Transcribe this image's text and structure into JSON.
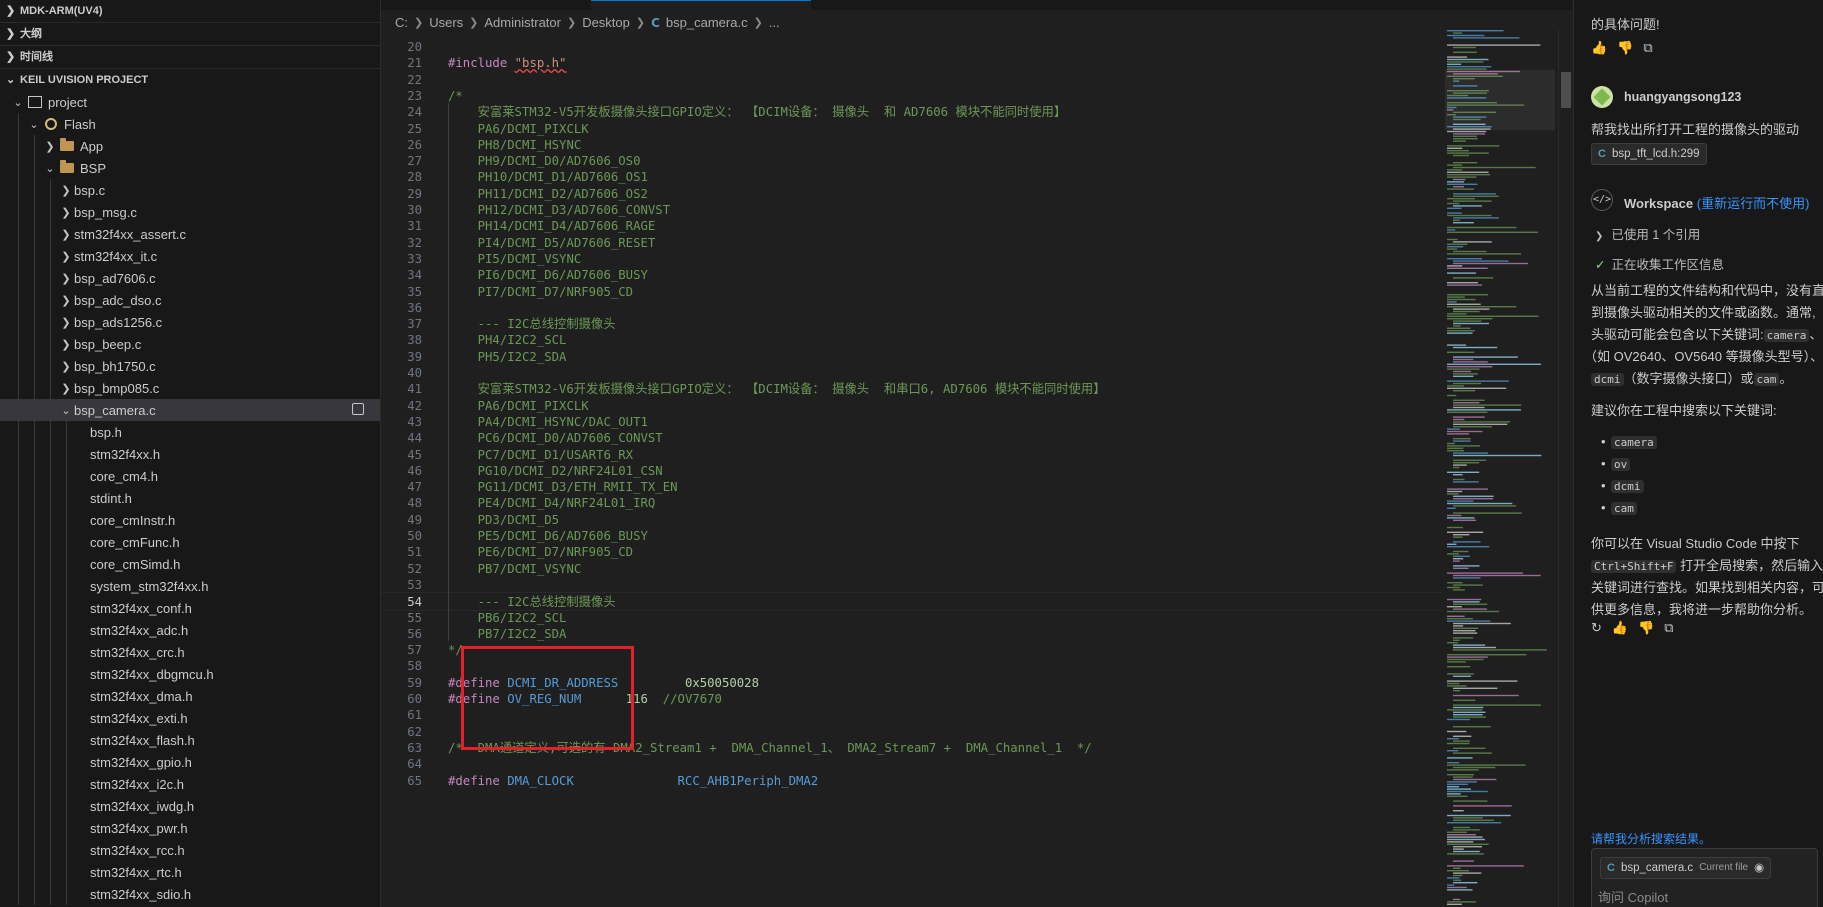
{
  "explorer": {
    "sections": [
      {
        "label": "MDK-ARM(UV4)",
        "expanded": false
      },
      {
        "label": "大纲",
        "expanded": false
      },
      {
        "label": "时间线",
        "expanded": false
      },
      {
        "label": "KEIL UVISION PROJECT",
        "expanded": true
      }
    ],
    "tree": [
      {
        "label": "project",
        "depth": 1,
        "chevron": "down",
        "icon": "project-icon"
      },
      {
        "label": "Flash",
        "depth": 2,
        "chevron": "down",
        "icon": "flash-target-icon"
      },
      {
        "label": "App",
        "depth": 3,
        "chevron": "right",
        "icon": "folder-icon"
      },
      {
        "label": "BSP",
        "depth": 3,
        "chevron": "down",
        "icon": "folder-icon"
      },
      {
        "label": "bsp.c",
        "depth": 4,
        "chevron": "right"
      },
      {
        "label": "bsp_msg.c",
        "depth": 4,
        "chevron": "right"
      },
      {
        "label": "stm32f4xx_assert.c",
        "depth": 4,
        "chevron": "right"
      },
      {
        "label": "stm32f4xx_it.c",
        "depth": 4,
        "chevron": "right"
      },
      {
        "label": "bsp_ad7606.c",
        "depth": 4,
        "chevron": "right"
      },
      {
        "label": "bsp_adc_dso.c",
        "depth": 4,
        "chevron": "right"
      },
      {
        "label": "bsp_ads1256.c",
        "depth": 4,
        "chevron": "right"
      },
      {
        "label": "bsp_beep.c",
        "depth": 4,
        "chevron": "right"
      },
      {
        "label": "bsp_bh1750.c",
        "depth": 4,
        "chevron": "right"
      },
      {
        "label": "bsp_bmp085.c",
        "depth": 4,
        "chevron": "right"
      },
      {
        "label": "bsp_camera.c",
        "depth": 4,
        "chevron": "down",
        "selected": true
      },
      {
        "label": "bsp.h",
        "depth": 5
      },
      {
        "label": "stm32f4xx.h",
        "depth": 5
      },
      {
        "label": "core_cm4.h",
        "depth": 5
      },
      {
        "label": "stdint.h",
        "depth": 5
      },
      {
        "label": "core_cmInstr.h",
        "depth": 5
      },
      {
        "label": "core_cmFunc.h",
        "depth": 5
      },
      {
        "label": "core_cmSimd.h",
        "depth": 5
      },
      {
        "label": "system_stm32f4xx.h",
        "depth": 5
      },
      {
        "label": "stm32f4xx_conf.h",
        "depth": 5
      },
      {
        "label": "stm32f4xx_adc.h",
        "depth": 5
      },
      {
        "label": "stm32f4xx_crc.h",
        "depth": 5
      },
      {
        "label": "stm32f4xx_dbgmcu.h",
        "depth": 5
      },
      {
        "label": "stm32f4xx_dma.h",
        "depth": 5
      },
      {
        "label": "stm32f4xx_exti.h",
        "depth": 5
      },
      {
        "label": "stm32f4xx_flash.h",
        "depth": 5
      },
      {
        "label": "stm32f4xx_gpio.h",
        "depth": 5
      },
      {
        "label": "stm32f4xx_i2c.h",
        "depth": 5
      },
      {
        "label": "stm32f4xx_iwdg.h",
        "depth": 5
      },
      {
        "label": "stm32f4xx_pwr.h",
        "depth": 5
      },
      {
        "label": "stm32f4xx_rcc.h",
        "depth": 5
      },
      {
        "label": "stm32f4xx_rtc.h",
        "depth": 5
      },
      {
        "label": "stm32f4xx_sdio.h",
        "depth": 5
      }
    ]
  },
  "breadcrumb": [
    "C:",
    "Users",
    "Administrator",
    "Desktop",
    "bsp_camera.c",
    "..."
  ],
  "editor": {
    "current_line": 54,
    "lines": [
      {
        "n": 20,
        "segs": []
      },
      {
        "n": 21,
        "segs": [
          {
            "c": "kw",
            "t": "#include"
          },
          {
            "c": "plain",
            "t": " "
          },
          {
            "c": "str squig",
            "t": "\"bsp.h\""
          }
        ]
      },
      {
        "n": 22,
        "segs": []
      },
      {
        "n": 23,
        "segs": [
          {
            "c": "cm",
            "t": "/*"
          }
        ]
      },
      {
        "n": 24,
        "segs": [
          {
            "c": "cm",
            "t": "    安富莱STM32-V5开发板摄像头接口GPIO定义： 【DCIM设备： 摄像头  和 AD7606 模块不能同时使用】"
          }
        ]
      },
      {
        "n": 25,
        "segs": [
          {
            "c": "cm",
            "t": "    PA6/DCMI_PIXCLK"
          }
        ]
      },
      {
        "n": 26,
        "segs": [
          {
            "c": "cm",
            "t": "    PH8/DCMI_HSYNC"
          }
        ]
      },
      {
        "n": 27,
        "segs": [
          {
            "c": "cm",
            "t": "    PH9/DCMI_D0/AD7606_OS0"
          }
        ]
      },
      {
        "n": 28,
        "segs": [
          {
            "c": "cm",
            "t": "    PH10/DCMI_D1/AD7606_OS1"
          }
        ]
      },
      {
        "n": 29,
        "segs": [
          {
            "c": "cm",
            "t": "    PH11/DCMI_D2/AD7606_OS2"
          }
        ]
      },
      {
        "n": 30,
        "segs": [
          {
            "c": "cm",
            "t": "    PH12/DCMI_D3/AD7606_CONVST"
          }
        ]
      },
      {
        "n": 31,
        "segs": [
          {
            "c": "cm",
            "t": "    PH14/DCMI_D4/AD7606_RAGE"
          }
        ]
      },
      {
        "n": 32,
        "segs": [
          {
            "c": "cm",
            "t": "    PI4/DCMI_D5/AD7606_RESET"
          }
        ]
      },
      {
        "n": 33,
        "segs": [
          {
            "c": "cm",
            "t": "    PI5/DCMI_VSYNC"
          }
        ]
      },
      {
        "n": 34,
        "segs": [
          {
            "c": "cm",
            "t": "    PI6/DCMI_D6/AD7606_BUSY"
          }
        ]
      },
      {
        "n": 35,
        "segs": [
          {
            "c": "cm",
            "t": "    PI7/DCMI_D7/NRF905_CD"
          }
        ]
      },
      {
        "n": 36,
        "segs": []
      },
      {
        "n": 37,
        "segs": [
          {
            "c": "cm",
            "t": "    --- I2C总线控制摄像头"
          }
        ]
      },
      {
        "n": 38,
        "segs": [
          {
            "c": "cm",
            "t": "    PH4/I2C2_SCL"
          }
        ]
      },
      {
        "n": 39,
        "segs": [
          {
            "c": "cm",
            "t": "    PH5/I2C2_SDA"
          }
        ]
      },
      {
        "n": 40,
        "segs": []
      },
      {
        "n": 41,
        "segs": [
          {
            "c": "cm",
            "t": "    安富莱STM32-V6开发板摄像头接口GPIO定义： 【DCIM设备： 摄像头  和串口6, AD7606 模块不能同时使用】"
          }
        ]
      },
      {
        "n": 42,
        "segs": [
          {
            "c": "cm",
            "t": "    PA6/DCMI_PIXCLK"
          }
        ]
      },
      {
        "n": 43,
        "segs": [
          {
            "c": "cm",
            "t": "    PA4/DCMI_HSYNC/DAC_OUT1"
          }
        ]
      },
      {
        "n": 44,
        "segs": [
          {
            "c": "cm",
            "t": "    PC6/DCMI_D0/AD7606_CONVST"
          }
        ]
      },
      {
        "n": 45,
        "segs": [
          {
            "c": "cm",
            "t": "    PC7/DCMI_D1/USART6_RX"
          }
        ]
      },
      {
        "n": 46,
        "segs": [
          {
            "c": "cm",
            "t": "    PG10/DCMI_D2/NRF24L01_CSN"
          }
        ]
      },
      {
        "n": 47,
        "segs": [
          {
            "c": "cm",
            "t": "    PG11/DCMI_D3/ETH_RMII_TX_EN"
          }
        ]
      },
      {
        "n": 48,
        "segs": [
          {
            "c": "cm",
            "t": "    PE4/DCMI_D4/NRF24L01_IRQ"
          }
        ]
      },
      {
        "n": 49,
        "segs": [
          {
            "c": "cm",
            "t": "    PD3/DCMI_D5"
          }
        ]
      },
      {
        "n": 50,
        "segs": [
          {
            "c": "cm",
            "t": "    PE5/DCMI_D6/AD7606_BUSY"
          }
        ]
      },
      {
        "n": 51,
        "segs": [
          {
            "c": "cm",
            "t": "    PE6/DCMI_D7/NRF905_CD"
          }
        ]
      },
      {
        "n": 52,
        "segs": [
          {
            "c": "cm",
            "t": "    PB7/DCMI_VSYNC"
          }
        ]
      },
      {
        "n": 53,
        "segs": []
      },
      {
        "n": 54,
        "segs": [
          {
            "c": "cm",
            "t": "    --- I2C总线控制摄像头"
          }
        ]
      },
      {
        "n": 55,
        "segs": [
          {
            "c": "cm",
            "t": "    PB6/I2C2_SCL"
          }
        ]
      },
      {
        "n": 56,
        "segs": [
          {
            "c": "cm",
            "t": "    PB7/I2C2_SDA"
          }
        ]
      },
      {
        "n": 57,
        "segs": [
          {
            "c": "cm",
            "t": "*/"
          }
        ]
      },
      {
        "n": 58,
        "segs": []
      },
      {
        "n": 59,
        "segs": [
          {
            "c": "kw",
            "t": "#define"
          },
          {
            "c": "plain",
            "t": " "
          },
          {
            "c": "mac",
            "t": "DCMI_DR_ADDRESS"
          },
          {
            "c": "plain",
            "t": "         "
          },
          {
            "c": "num",
            "t": "0x50050028"
          }
        ]
      },
      {
        "n": 60,
        "segs": [
          {
            "c": "kw",
            "t": "#define"
          },
          {
            "c": "plain",
            "t": " "
          },
          {
            "c": "mac",
            "t": "OV_REG_NUM"
          },
          {
            "c": "plain",
            "t": "      "
          },
          {
            "c": "num",
            "t": "116"
          },
          {
            "c": "plain",
            "t": "  "
          },
          {
            "c": "cm",
            "t": "//OV7670"
          }
        ]
      },
      {
        "n": 61,
        "segs": []
      },
      {
        "n": 62,
        "segs": []
      },
      {
        "n": 63,
        "segs": [
          {
            "c": "cm",
            "t": "/*  DMA通道定义,可选的有 DMA2_Stream1 +  DMA_Channel_1、 DMA2_Stream7 +  DMA_Channel_1  */"
          }
        ]
      },
      {
        "n": 64,
        "segs": []
      },
      {
        "n": 65,
        "segs": [
          {
            "c": "kw",
            "t": "#define"
          },
          {
            "c": "plain",
            "t": " "
          },
          {
            "c": "mac",
            "t": "DMA_CLOCK"
          },
          {
            "c": "plain",
            "t": "              "
          },
          {
            "c": "mac",
            "t": "RCC_AHB1Periph_DMA2"
          }
        ]
      }
    ]
  },
  "chat": {
    "top_text": "的具体问题!",
    "user_name": "huangyangsong123",
    "user_message": "帮我找出所打开工程的摄像头的驱动",
    "user_ref_chip": "bsp_tft_lcd.h:299",
    "agent_name": "Workspace",
    "agent_rerun": "(重新运行而不使用)",
    "used_refs": "已使用 1 个引用",
    "collecting": "正在收集工作区信息",
    "para1_l1": "从当前工程的文件结构和代码中，没有直",
    "para1_l2": "到摄像头驱动相关的文件或函数。通常,",
    "para1_l3a": "头驱动可能会包含以下关键词:",
    "para1_l3code": "camera",
    "para1_l3b": "、",
    "para1_l4": "（如 OV2640、OV5640 等摄像头型号）、",
    "para1_l5code1": "dcmi",
    "para1_l5mid": "（数字摄像头接口）或",
    "para1_l5code2": "cam",
    "para1_l5end": "。",
    "para2": "建议你在工程中搜索以下关键词:",
    "keywords": [
      "camera",
      "ov",
      "dcmi",
      "cam"
    ],
    "para3_l1": "你可以在 Visual Studio Code 中按下",
    "para3_l2code": "Ctrl+Shift+F",
    "para3_l2": "打开全局搜索，然后输入",
    "para3_l3": "关键词进行查找。如果找到相关内容，可",
    "para3_l4": "供更多信息，我将进一步帮助你分析。",
    "suggestion": "请帮我分析搜索结果。",
    "current_file_chip": "bsp_camera.c",
    "current_file_label": "Current file",
    "input_placeholder": "询问 Copilot"
  }
}
